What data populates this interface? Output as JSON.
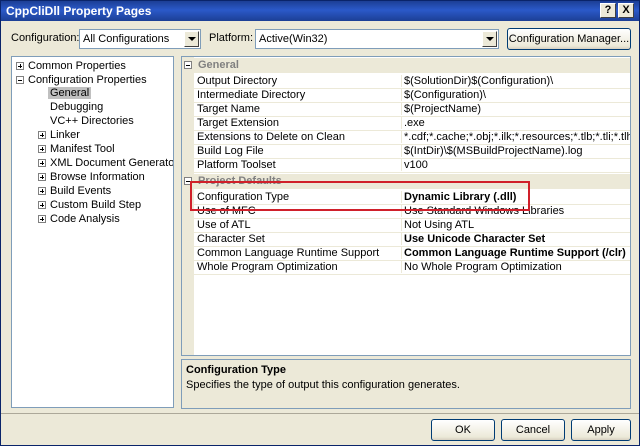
{
  "window": {
    "title": "CppCliDll Property Pages",
    "help_label": "?",
    "close_label": "X"
  },
  "toolbar": {
    "configuration_label": "Configuration:",
    "configuration_value": "All Configurations",
    "platform_label": "Platform:",
    "platform_value": "Active(Win32)",
    "config_manager_label": "Configuration Manager..."
  },
  "tree": {
    "items": [
      {
        "label": "Common Properties",
        "expander": "plus"
      },
      {
        "label": "Configuration Properties",
        "expander": "minus"
      },
      {
        "label": "General",
        "expander": "none"
      },
      {
        "label": "Debugging",
        "expander": "none"
      },
      {
        "label": "VC++ Directories",
        "expander": "none"
      },
      {
        "label": "Linker",
        "expander": "plus"
      },
      {
        "label": "Manifest Tool",
        "expander": "plus"
      },
      {
        "label": "XML Document Generator",
        "expander": "plus"
      },
      {
        "label": "Browse Information",
        "expander": "plus"
      },
      {
        "label": "Build Events",
        "expander": "plus"
      },
      {
        "label": "Custom Build Step",
        "expander": "plus"
      },
      {
        "label": "Code Analysis",
        "expander": "plus"
      }
    ]
  },
  "grid": {
    "general_category": "General",
    "general_rows": [
      {
        "name": "Output Directory",
        "value": "$(SolutionDir)$(Configuration)\\"
      },
      {
        "name": "Intermediate Directory",
        "value": "$(Configuration)\\"
      },
      {
        "name": "Target Name",
        "value": "$(ProjectName)"
      },
      {
        "name": "Target Extension",
        "value": ".exe"
      },
      {
        "name": "Extensions to Delete on Clean",
        "value": "*.cdf;*.cache;*.obj;*.ilk;*.resources;*.tlb;*.tli;*.tlh;*."
      },
      {
        "name": "Build Log File",
        "value": "$(IntDir)\\$(MSBuildProjectName).log"
      },
      {
        "name": "Platform Toolset",
        "value": "v100"
      }
    ],
    "defaults_category": "Project Defaults",
    "defaults_rows": [
      {
        "name": "Configuration Type",
        "value": "Dynamic Library (.dll)"
      },
      {
        "name": "Use of MFC",
        "value": "Use Standard Windows Libraries"
      },
      {
        "name": "Use of ATL",
        "value": "Not Using ATL"
      },
      {
        "name": "Character Set",
        "value": "Use Unicode Character Set"
      },
      {
        "name": "Common Language Runtime Support",
        "value": "Common Language Runtime Support (/clr)"
      },
      {
        "name": "Whole Program Optimization",
        "value": "No Whole Program Optimization"
      }
    ]
  },
  "description": {
    "title": "Configuration Type",
    "text": "Specifies the type of output this configuration generates."
  },
  "buttons": {
    "ok": "OK",
    "cancel": "Cancel",
    "apply": "Apply"
  }
}
